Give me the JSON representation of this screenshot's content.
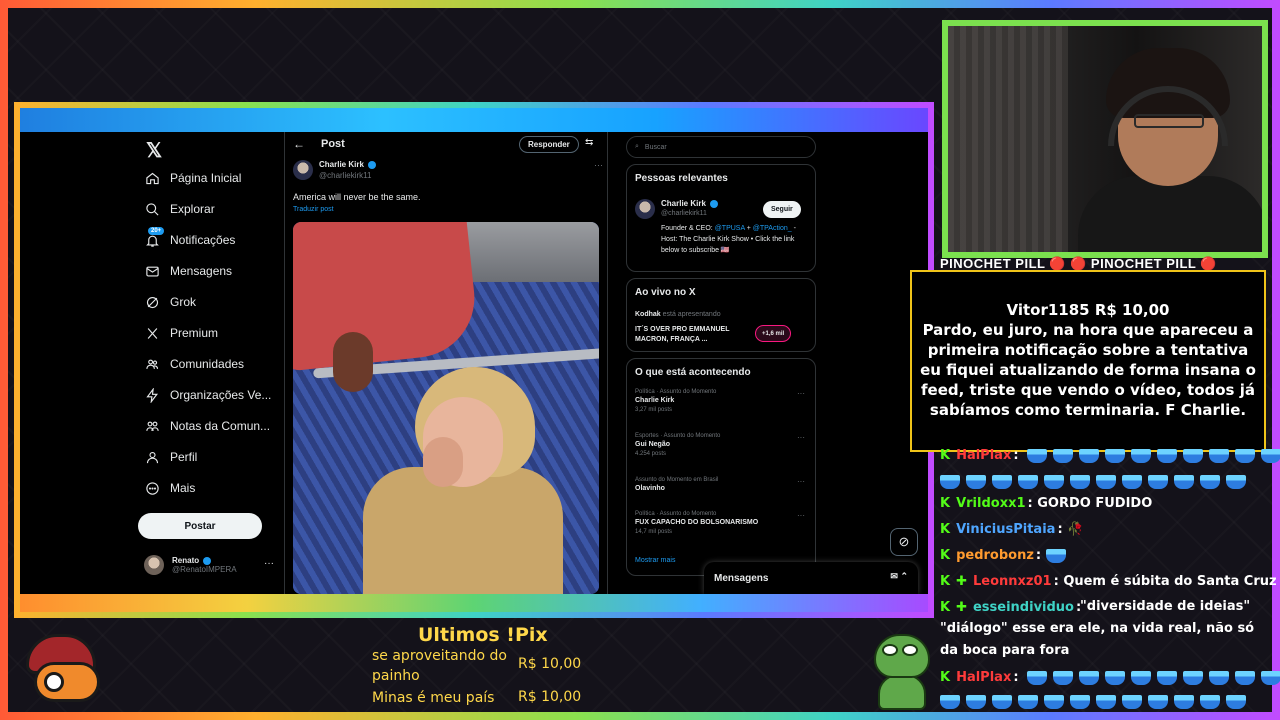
{
  "x": {
    "nav": [
      {
        "label": "Página Inicial",
        "icon": "home-icon"
      },
      {
        "label": "Explorar",
        "icon": "search-icon"
      },
      {
        "label": "Notificações",
        "icon": "bell-icon"
      },
      {
        "label": "Mensagens",
        "icon": "mail-icon"
      },
      {
        "label": "Grok",
        "icon": "grok-icon"
      },
      {
        "label": "Premium",
        "icon": "x-icon"
      },
      {
        "label": "Comunidades",
        "icon": "people-icon"
      },
      {
        "label": "Organizações Ve...",
        "icon": "lightning-icon"
      },
      {
        "label": "Notas da Comun...",
        "icon": "notes-icon"
      },
      {
        "label": "Perfil",
        "icon": "person-icon"
      },
      {
        "label": "Mais",
        "icon": "more-icon"
      }
    ],
    "notif_badge": "20+",
    "post_button": "Postar",
    "profile": {
      "name": "Renato",
      "handle": "@RenatoIMPERA"
    },
    "header": {
      "title": "Post",
      "reply": "Responder"
    },
    "tweet": {
      "author": "Charlie Kirk",
      "handle": "@charliekirk11",
      "text": "America will never be the same.",
      "translate": "Traduzir post"
    },
    "search_placeholder": "Buscar",
    "relevant": {
      "title": "Pessoas relevantes",
      "name": "Charlie Kirk",
      "handle": "@charliekirk11",
      "follow": "Seguir",
      "bio_1": "Founder & CEO: ",
      "bio_link1": "@TPUSA",
      "bio_2": " + ",
      "bio_link2": "@TPAction_",
      "bio_3": " - Host: The Charlie Kirk Show • Click the link below to subscribe 🇺🇸"
    },
    "live": {
      "title": "Ao vivo no X",
      "user": "Kodhak",
      "status": "está apresentando",
      "stream_title": "IT´S OVER PRO EMMANUEL MACRON, FRANÇA ...",
      "viewers": "+1,6 mil"
    },
    "trends": {
      "title": "O que está acontecendo",
      "items": [
        {
          "meta": "Política · Assunto do Momento",
          "name": "Charlie Kirk",
          "count": "3,27 mil posts"
        },
        {
          "meta": "Esportes · Assunto do Momento",
          "name": "Gui Negão",
          "count": "4.254 posts"
        },
        {
          "meta": "Assunto do Momento em Brasil",
          "name": "Olavinho",
          "count": ""
        },
        {
          "meta": "Política · Assunto do Momento",
          "name": "FUX CAPACHO DO BOLSONARISMO",
          "count": "14,7 mil posts"
        }
      ],
      "show_more": "Mostrar mais"
    },
    "messages": "Mensagens"
  },
  "stream": {
    "ticker": "PINOCHET PILL 🔴 🔴 PINOCHET PILL 🔴",
    "alert": {
      "head": "Vitor1185 R$ 10,00",
      "body": "Pardo, eu juro, na hora que apareceu a primeira notificação sobre a tentativa eu fiquei atualizando de forma insana o feed, triste que vendo o vídeo, todos já sabíamos como terminaria. F Charlie."
    },
    "chat": [
      {
        "user": "HalPlax",
        "color": "#ff3b3b",
        "text": ""
      },
      {
        "user": "Vrildoxx1",
        "color": "#53fc18",
        "text": "GORDO FUDIDO"
      },
      {
        "user": "ViniciusPitaia",
        "color": "#4fa6ff",
        "text": "🥀"
      },
      {
        "user": "pedrobonz",
        "color": "#ff9b2f",
        "text": ""
      },
      {
        "user": "Leonnxz01",
        "color": "#ff3b3b",
        "text": "Quem é súbita do Santa Cruz"
      },
      {
        "user": "esseindividuo",
        "color": "#3fd3c6",
        "text": "\"diversidade de ideias\" \"diálogo\" esse era ele, na vida real, não só da boca para fora"
      },
      {
        "user": "HalPlax",
        "color": "#ff3b3b",
        "text": ""
      }
    ],
    "pix": {
      "title": "Ultimos !Pix",
      "items": [
        {
          "text": "se aproveitando do painho",
          "amount": "R$ 10,00"
        },
        {
          "text": "Minas é meu país",
          "amount": "R$ 10,00"
        }
      ]
    }
  }
}
